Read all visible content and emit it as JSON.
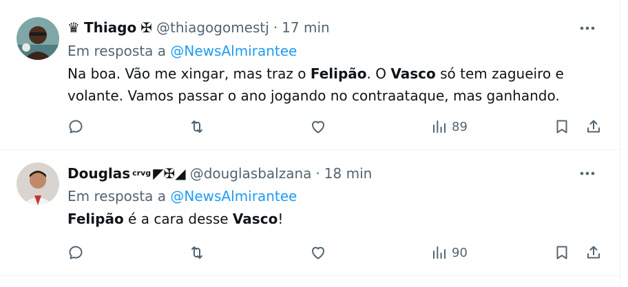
{
  "colors": {
    "text": "#0f1419",
    "secondary": "#536471",
    "link": "#1d9bf0",
    "divider": "#eff3f4"
  },
  "tweets": [
    {
      "name_prefix": "♛",
      "name": "Thiago",
      "name_suffix": "✠",
      "handle": "@thiagogomestj",
      "separator": "·",
      "time": "17 min",
      "reply_prefix": "Em resposta a",
      "reply_mention": "@NewsAlmirantee",
      "body": [
        {
          "text": "Na boa. Vão me xingar, mas traz o ",
          "bold": false
        },
        {
          "text": "Felipão",
          "bold": true
        },
        {
          "text": ". O ",
          "bold": false
        },
        {
          "text": "Vasco",
          "bold": true
        },
        {
          "text": " só tem zagueiro e volante. Vamos passar o ano jogando no contraataque, mas ganhando.",
          "bold": false
        }
      ],
      "views": "89",
      "icons": [
        "more-icon",
        "reply-icon",
        "retweet-icon",
        "like-icon",
        "views-icon",
        "bookmark-icon",
        "share-icon"
      ]
    },
    {
      "name": "Douglas",
      "name_sup": "crvg",
      "name_suffix": "◤✠◢",
      "handle": "@douglasbalzana",
      "separator": "·",
      "time": "18 min",
      "reply_prefix": "Em resposta a",
      "reply_mention": "@NewsAlmirantee",
      "body": [
        {
          "text": "Felipão",
          "bold": true
        },
        {
          "text": " é a cara desse ",
          "bold": false
        },
        {
          "text": "Vasco",
          "bold": true
        },
        {
          "text": "!",
          "bold": false
        }
      ],
      "views": "90",
      "icons": [
        "more-icon",
        "reply-icon",
        "retweet-icon",
        "like-icon",
        "views-icon",
        "bookmark-icon",
        "share-icon"
      ]
    }
  ]
}
